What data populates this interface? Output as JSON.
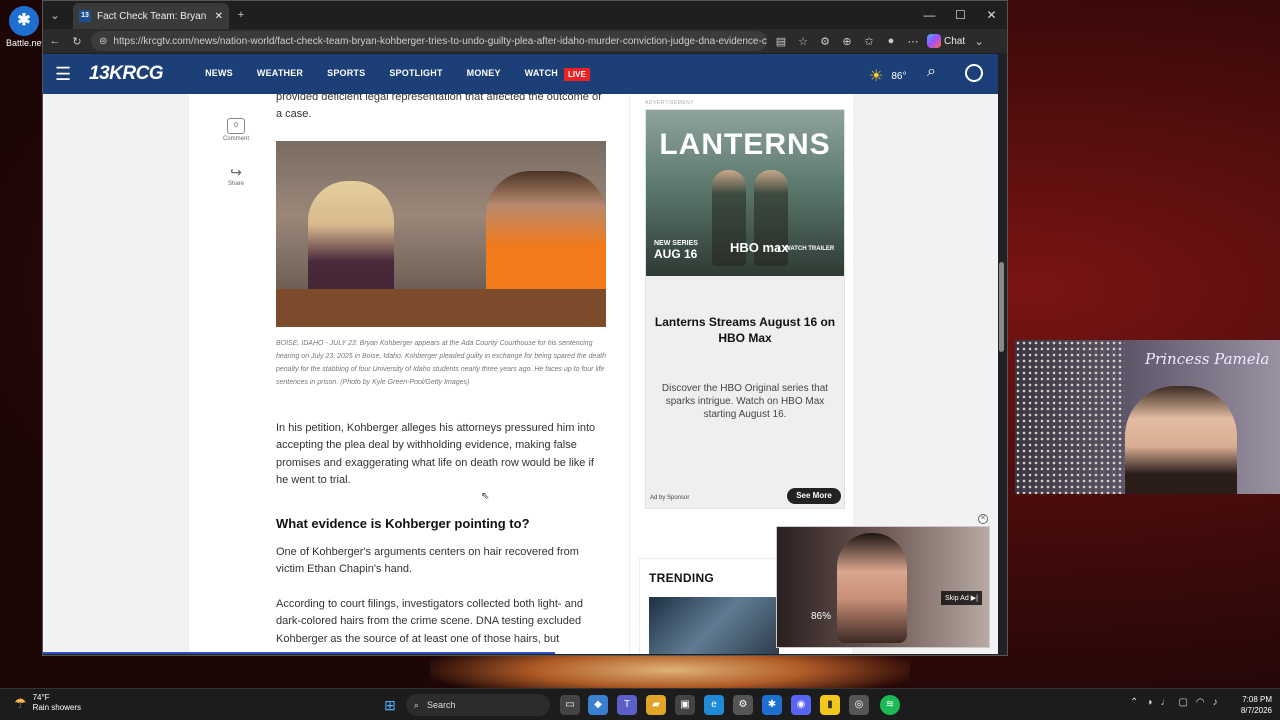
{
  "desktop": {
    "icon_label": "Battle.net"
  },
  "browser": {
    "tab_title": "Fact Check Team: Bryan Kohberger",
    "url": "https://krcgtv.com/news/nation-world/fact-check-team-bryan-kohberger-tries-to-undo-guilty-plea-after-idaho-murder-conviction-judge-dna-evidence-crime-...",
    "chat_label": "Chat"
  },
  "site": {
    "logo": "13KRCG",
    "nav": [
      "NEWS",
      "WEATHER",
      "SPORTS",
      "SPOTLIGHT",
      "MONEY",
      "WATCH"
    ],
    "live_label": "LIVE",
    "temperature": "86°"
  },
  "social": {
    "comment_count": "0",
    "comment_label": "Comment",
    "share_label": "Share"
  },
  "article": {
    "intro_tail": "provided deficient legal representation that affected the outcome of a case.",
    "caption": "BOISE, IDAHO - JULY 23: Bryan Kohberger appears at the Ada County Courthouse for his sentencing hearing on July 23, 2025 in Boise, Idaho. Kohberger pleaded guilty in exchange for being spared the death penalty for the stabbing of four University of Idaho students nearly three years ago. He faces up to four life sentences in prison. (Photo by Kyle Green-Pool/Getty Images)",
    "para1": "In his petition, Kohberger alleges his attorneys pressured him into accepting the plea deal by withholding evidence, making false promises and exaggerating what life on death row would be like if he went to trial.",
    "heading": "What evidence is Kohberger pointing to?",
    "para2": "One of Kohberger's arguments centers on hair recovered from victim Ethan Chapin's hand.",
    "para3": "According to court filings, investigators collected both light- and dark-colored hairs from the crime scene. DNA testing excluded Kohberger as the source of at least one of those hairs, but"
  },
  "ad": {
    "label": "ADVERTISEMENT",
    "poster_title": "LANTERNS",
    "promo_line": "NEW SERIES",
    "promo_date": "AUG 16",
    "network": "HBO max",
    "trailer": "WATCH TRAILER",
    "headline": "Lanterns Streams August 16 on HBO Max",
    "body": "Discover the HBO Original series that sparks intrigue. Watch on HBO Max starting August 16.",
    "sponsor": "Ad by Sponsor",
    "cta": "See More"
  },
  "trending": {
    "label": "TRENDING"
  },
  "video_ad": {
    "percent": "86%",
    "skip_label": "Skip Ad"
  },
  "webcam": {
    "name": "Princess Pamela"
  },
  "taskbar": {
    "weather_temp": "74°F",
    "weather_desc": "Rain showers",
    "search_placeholder": "Search",
    "time": "7:08 PM",
    "date": "8/7/2026"
  }
}
